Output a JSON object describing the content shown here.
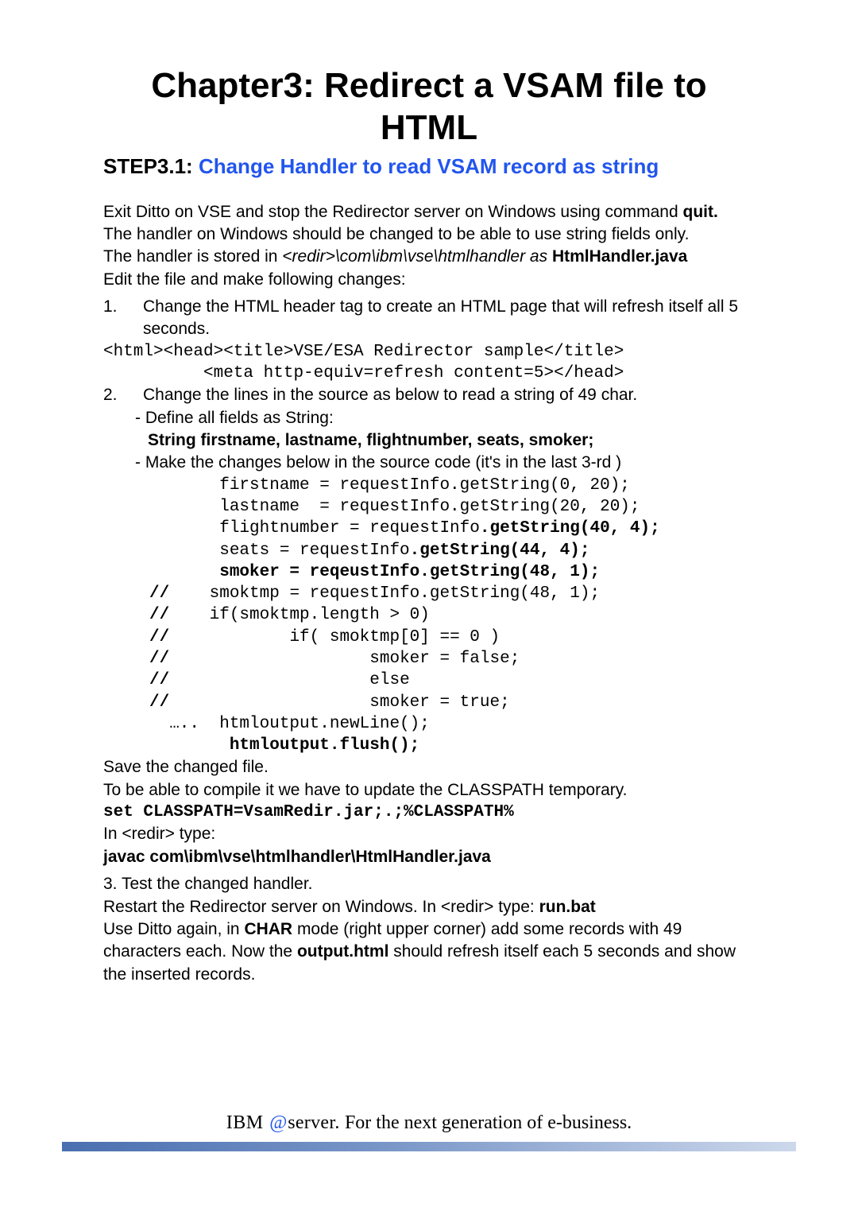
{
  "title": "Chapter3: Redirect a VSAM file to HTML",
  "step": {
    "label": "STEP3.1: ",
    "title": "Change Handler to read VSAM record as string"
  },
  "p1a": "Exit Ditto on VSE and stop the Redirector server on Windows using command ",
  "p1b": "quit.",
  "p2": "The handler on Windows should be changed to be able to use string fields only.",
  "p3a": "The handler is stored in ",
  "p3b": "<redir>\\com\\ibm\\vse\\htmlhandler   as  ",
  "p3c": "HtmlHandler.java",
  "p4": "Edit the file and make following changes:",
  "item1": {
    "num": "1.",
    "text": "Change the HTML header tag to create an HTML page that will refresh itself all 5 seconds."
  },
  "code1a": "<html><head><title>VSE/ESA Redirector sample</title>",
  "code1b": "          <meta http-equiv=refresh content=5></head>",
  "item2": {
    "num": "2.",
    "text": " Change the lines in the source as below to read a string of 49 char."
  },
  "item2a_prefix": "- Define all fields as String:",
  "item2a_bold": "  String firstname, lastname, flightnumber, seats, smoker;",
  "item2b": "- Make the changes below in the source code (it's in the last 3-rd )",
  "code_c1": "       firstname = requestInfo.getString(0, 20);",
  "code_c2": "       lastname  = requestInfo.getString(20, 20);",
  "code_c3a": "       flightnumber = requestInfo",
  "code_c3b": ".getString(40, 4);",
  "code_c4a": "       seats = requestInfo",
  "code_c4b": ".getString(44, 4);",
  "code_c5": "       smoker = reqeustInfo.getString(48, 1);",
  "code_c6a": "//",
  "code_c6b": "    smoktmp = requestInfo.getString(48, 1);",
  "code_c7a": "//",
  "code_c7b": "    if(smoktmp.length > 0)",
  "code_c8a": "//",
  "code_c8b": "            if( smoktmp[0] == 0 )",
  "code_c9a": "//",
  "code_c9b": "                    smoker = false;",
  "code_c10a": "//",
  "code_c10b": "                    else",
  "code_c11a": "//",
  "code_c11b": "                    smoker = true;",
  "code_c12": "  …..  htmloutput.newLine();",
  "code_c13": "        htmloutput.flush();",
  "p5": "Save the changed file.",
  "p6": "To be able to compile it we have to update the CLASSPATH temporary.",
  "code_set": "set CLASSPATH=VsamRedir.jar;.;%CLASSPATH%",
  "p7": "In <redir> type:",
  "p8": "javac com\\ibm\\vse\\htmlhandler\\HtmlHandler.java",
  "p9": "3. Test the changed handler.",
  "p10a": "Restart the Redirector server on Windows. In <redir>  type:  ",
  "p10b": "run.bat",
  "p11a": "Use Ditto again, in ",
  "p11b": "CHAR",
  "p11c": " mode (right upper corner) add some records with 49 characters each. Now the ",
  "p11d": "output.html",
  "p11e": " should refresh itself each 5 seconds and show the inserted records.",
  "footer": {
    "ibm": "IBM ",
    "at": "@",
    "server": "server.  ",
    "rest": "For the next generation of e-business."
  }
}
